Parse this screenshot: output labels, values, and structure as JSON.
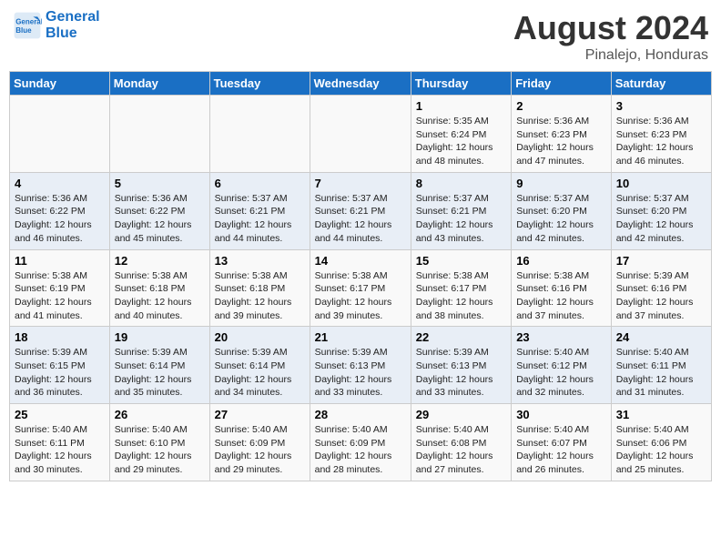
{
  "header": {
    "logo_line1": "General",
    "logo_line2": "Blue",
    "title": "August 2024",
    "location": "Pinalejo, Honduras"
  },
  "weekdays": [
    "Sunday",
    "Monday",
    "Tuesday",
    "Wednesday",
    "Thursday",
    "Friday",
    "Saturday"
  ],
  "weeks": [
    [
      {
        "day": "",
        "detail": ""
      },
      {
        "day": "",
        "detail": ""
      },
      {
        "day": "",
        "detail": ""
      },
      {
        "day": "",
        "detail": ""
      },
      {
        "day": "1",
        "detail": "Sunrise: 5:35 AM\nSunset: 6:24 PM\nDaylight: 12 hours\nand 48 minutes."
      },
      {
        "day": "2",
        "detail": "Sunrise: 5:36 AM\nSunset: 6:23 PM\nDaylight: 12 hours\nand 47 minutes."
      },
      {
        "day": "3",
        "detail": "Sunrise: 5:36 AM\nSunset: 6:23 PM\nDaylight: 12 hours\nand 46 minutes."
      }
    ],
    [
      {
        "day": "4",
        "detail": "Sunrise: 5:36 AM\nSunset: 6:22 PM\nDaylight: 12 hours\nand 46 minutes."
      },
      {
        "day": "5",
        "detail": "Sunrise: 5:36 AM\nSunset: 6:22 PM\nDaylight: 12 hours\nand 45 minutes."
      },
      {
        "day": "6",
        "detail": "Sunrise: 5:37 AM\nSunset: 6:21 PM\nDaylight: 12 hours\nand 44 minutes."
      },
      {
        "day": "7",
        "detail": "Sunrise: 5:37 AM\nSunset: 6:21 PM\nDaylight: 12 hours\nand 44 minutes."
      },
      {
        "day": "8",
        "detail": "Sunrise: 5:37 AM\nSunset: 6:21 PM\nDaylight: 12 hours\nand 43 minutes."
      },
      {
        "day": "9",
        "detail": "Sunrise: 5:37 AM\nSunset: 6:20 PM\nDaylight: 12 hours\nand 42 minutes."
      },
      {
        "day": "10",
        "detail": "Sunrise: 5:37 AM\nSunset: 6:20 PM\nDaylight: 12 hours\nand 42 minutes."
      }
    ],
    [
      {
        "day": "11",
        "detail": "Sunrise: 5:38 AM\nSunset: 6:19 PM\nDaylight: 12 hours\nand 41 minutes."
      },
      {
        "day": "12",
        "detail": "Sunrise: 5:38 AM\nSunset: 6:18 PM\nDaylight: 12 hours\nand 40 minutes."
      },
      {
        "day": "13",
        "detail": "Sunrise: 5:38 AM\nSunset: 6:18 PM\nDaylight: 12 hours\nand 39 minutes."
      },
      {
        "day": "14",
        "detail": "Sunrise: 5:38 AM\nSunset: 6:17 PM\nDaylight: 12 hours\nand 39 minutes."
      },
      {
        "day": "15",
        "detail": "Sunrise: 5:38 AM\nSunset: 6:17 PM\nDaylight: 12 hours\nand 38 minutes."
      },
      {
        "day": "16",
        "detail": "Sunrise: 5:38 AM\nSunset: 6:16 PM\nDaylight: 12 hours\nand 37 minutes."
      },
      {
        "day": "17",
        "detail": "Sunrise: 5:39 AM\nSunset: 6:16 PM\nDaylight: 12 hours\nand 37 minutes."
      }
    ],
    [
      {
        "day": "18",
        "detail": "Sunrise: 5:39 AM\nSunset: 6:15 PM\nDaylight: 12 hours\nand 36 minutes."
      },
      {
        "day": "19",
        "detail": "Sunrise: 5:39 AM\nSunset: 6:14 PM\nDaylight: 12 hours\nand 35 minutes."
      },
      {
        "day": "20",
        "detail": "Sunrise: 5:39 AM\nSunset: 6:14 PM\nDaylight: 12 hours\nand 34 minutes."
      },
      {
        "day": "21",
        "detail": "Sunrise: 5:39 AM\nSunset: 6:13 PM\nDaylight: 12 hours\nand 33 minutes."
      },
      {
        "day": "22",
        "detail": "Sunrise: 5:39 AM\nSunset: 6:13 PM\nDaylight: 12 hours\nand 33 minutes."
      },
      {
        "day": "23",
        "detail": "Sunrise: 5:40 AM\nSunset: 6:12 PM\nDaylight: 12 hours\nand 32 minutes."
      },
      {
        "day": "24",
        "detail": "Sunrise: 5:40 AM\nSunset: 6:11 PM\nDaylight: 12 hours\nand 31 minutes."
      }
    ],
    [
      {
        "day": "25",
        "detail": "Sunrise: 5:40 AM\nSunset: 6:11 PM\nDaylight: 12 hours\nand 30 minutes."
      },
      {
        "day": "26",
        "detail": "Sunrise: 5:40 AM\nSunset: 6:10 PM\nDaylight: 12 hours\nand 29 minutes."
      },
      {
        "day": "27",
        "detail": "Sunrise: 5:40 AM\nSunset: 6:09 PM\nDaylight: 12 hours\nand 29 minutes."
      },
      {
        "day": "28",
        "detail": "Sunrise: 5:40 AM\nSunset: 6:09 PM\nDaylight: 12 hours\nand 28 minutes."
      },
      {
        "day": "29",
        "detail": "Sunrise: 5:40 AM\nSunset: 6:08 PM\nDaylight: 12 hours\nand 27 minutes."
      },
      {
        "day": "30",
        "detail": "Sunrise: 5:40 AM\nSunset: 6:07 PM\nDaylight: 12 hours\nand 26 minutes."
      },
      {
        "day": "31",
        "detail": "Sunrise: 5:40 AM\nSunset: 6:06 PM\nDaylight: 12 hours\nand 25 minutes."
      }
    ]
  ]
}
